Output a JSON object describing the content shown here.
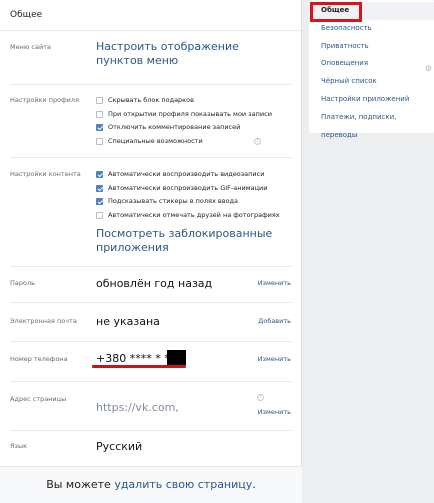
{
  "header": {
    "title": "Общее"
  },
  "menu_section": {
    "label": "Меню сайта",
    "link": "Настроить отображение пунктов меню"
  },
  "profile_settings": {
    "label": "Настройки профиля",
    "options": [
      {
        "label": "Скрывать блок подарков",
        "checked": false
      },
      {
        "label": "При открытии профиля показывать мои записи",
        "checked": false
      },
      {
        "label": "Отключить комментирование записей",
        "checked": true
      },
      {
        "label": "Специальные возможности",
        "checked": false
      }
    ]
  },
  "content_settings": {
    "label": "Настройки контента",
    "options": [
      {
        "label": "Автоматически воспроизводить видеозаписи",
        "checked": true
      },
      {
        "label": "Автоматически воспроизводить GIF-анимации",
        "checked": true
      },
      {
        "label": "Подсказывать стикеры в полях ввода",
        "checked": true
      },
      {
        "label": "Автоматически отмечать друзей на фотографиях",
        "checked": false
      }
    ],
    "blocked_apps_link": "Посмотреть заблокированные приложения"
  },
  "password": {
    "label": "Пароль",
    "value": "обновлён год назад",
    "action": "Изменить"
  },
  "email": {
    "label": "Электронная почта",
    "value": "не указана",
    "action": "Добавить"
  },
  "phone": {
    "label": "Номер телефона",
    "value": "+380 **** * **",
    "action": "Изменить"
  },
  "page_address": {
    "label": "Адрес страницы",
    "value": "https://vk.com,",
    "action": "Изменить"
  },
  "language": {
    "label": "Язык",
    "value": "Русский"
  },
  "footer": {
    "prefix": "Вы можете ",
    "link": "удалить свою страницу",
    "suffix": "."
  },
  "sidebar": {
    "items": [
      {
        "label": "Общее",
        "active": true
      },
      {
        "label": "Безопасность",
        "active": false
      },
      {
        "label": "Приватность",
        "active": false
      },
      {
        "label": "Оповещения",
        "active": false
      },
      {
        "label": "Чёрный список",
        "active": false
      },
      {
        "label": "Настройки приложений",
        "active": false
      },
      {
        "label": "Платежи, подписки, переводы",
        "active": false
      }
    ]
  },
  "colors": {
    "link": "#2a5885",
    "accent": "#5181b8",
    "highlight": "#d7141a"
  }
}
